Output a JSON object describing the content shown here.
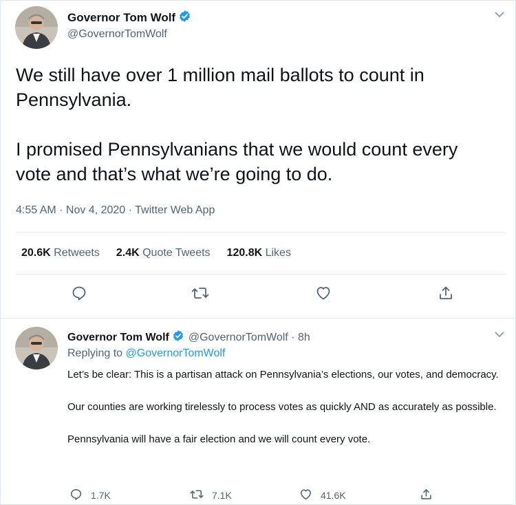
{
  "main_tweet": {
    "author_name": "Governor Tom Wolf",
    "handle": "@GovernorTomWolf",
    "paragraphs": [
      "We still have over 1 million mail ballots to count in Pennsylvania.",
      "I promised Pennsylvanians that we would count every vote and that’s what we’re going to do."
    ],
    "meta": "4:55 AM · Nov 4, 2020 · Twitter Web App",
    "stats": {
      "retweets_count": "20.6K",
      "retweets_label": "Retweets",
      "quotes_count": "2.4K",
      "quotes_label": "Quote Tweets",
      "likes_count": "120.8K",
      "likes_label": "Likes"
    }
  },
  "reply_tweet": {
    "author_name": "Governor Tom Wolf",
    "handle_time": "@GovernorTomWolf · 8h",
    "replying_prefix": "Replying to",
    "replying_to": "@GovernorTomWolf",
    "paragraphs": [
      "Let’s be clear: This is a partisan attack on Pennsylvania’s elections, our votes, and democracy.",
      "Our counties are working tirelessly to process votes as quickly AND as accurately as possible.",
      "Pennsylvania will have a fair election and we will count every vote."
    ],
    "counts": {
      "replies": "1.7K",
      "retweets": "7.1K",
      "likes": "41.6K"
    }
  },
  "icons": {
    "verified": "verified-badge-icon",
    "caret": "chevron-down-icon",
    "reply": "reply-icon",
    "retweet": "retweet-icon",
    "like": "heart-icon",
    "share": "share-icon"
  },
  "colors": {
    "accent": "#1d9bf0",
    "text": "#0f1419",
    "muted": "#536471"
  }
}
